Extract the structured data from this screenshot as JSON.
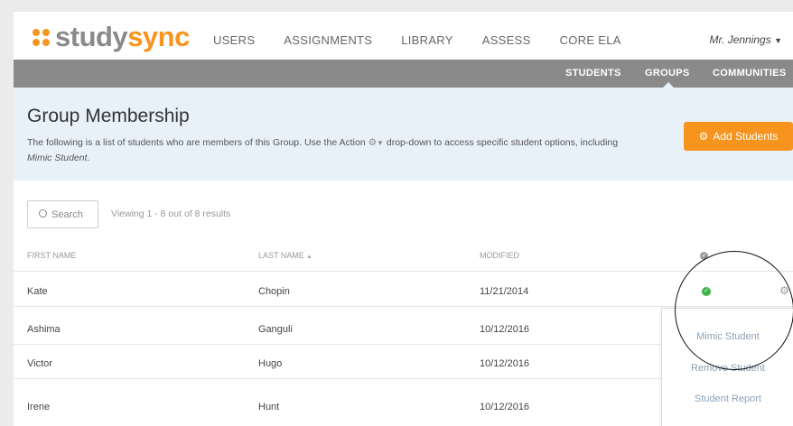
{
  "brand": {
    "prefix": "study",
    "highlight": "sync"
  },
  "main_nav": [
    "USERS",
    "ASSIGNMENTS",
    "LIBRARY",
    "ASSESS",
    "CORE ELA"
  ],
  "user_menu": {
    "label": "Mr. Jennings"
  },
  "sub_nav": [
    "STUDENTS",
    "GROUPS",
    "COMMUNITIES"
  ],
  "header": {
    "title": "Group Membership",
    "desc_pre": "The following is a list of students who are members of this Group. Use the Action",
    "desc_mid": "drop-down to access specific student options, including",
    "desc_em": "Mimic Student",
    "desc_end": ".",
    "add_button": "Add Students"
  },
  "search": {
    "label": "Search"
  },
  "viewing": "Viewing 1 - 8 out of 8 results",
  "table": {
    "columns": [
      "FIRST NAME",
      "LAST NAME",
      "MODIFIED"
    ],
    "rows": [
      {
        "first": "Kate",
        "last": "Chopin",
        "modified": "11/21/2014"
      },
      {
        "first": "Ashima",
        "last": "Ganguli",
        "modified": "10/12/2016"
      },
      {
        "first": "Victor",
        "last": "Hugo",
        "modified": "10/12/2016"
      },
      {
        "first": "Irene",
        "last": "Hunt",
        "modified": "10/12/2016"
      }
    ]
  },
  "action_menu": [
    "Mimic Student",
    "Remove Student",
    "Student Report"
  ],
  "colors": {
    "accent": "#f7941d",
    "subnav": "#8a8a8a",
    "header_bg": "#e8f1f8",
    "status_green": "#3cb24a",
    "menu_text": "#8aa2b7"
  }
}
